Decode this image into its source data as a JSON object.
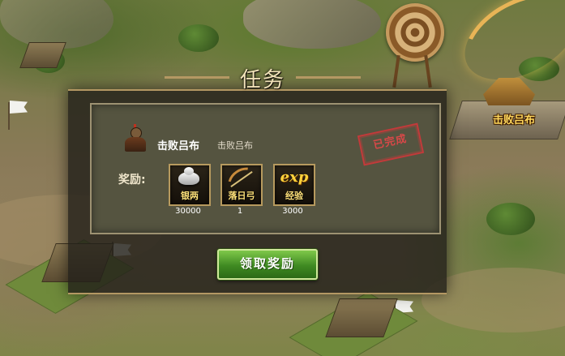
{
  "map": {
    "city_name": "击败吕布"
  },
  "dialog": {
    "title": "任务",
    "quest": {
      "name": "击败吕布",
      "description": "击败吕布",
      "status_stamp": "已完成"
    },
    "rewards_label": "奖励:",
    "rewards": [
      {
        "name": "银两",
        "quantity": "30000",
        "icon": "silver-ingot-icon"
      },
      {
        "name": "落日弓",
        "quantity": "1",
        "icon": "bow-icon"
      },
      {
        "name": "经验",
        "icon_text": "exp",
        "quantity": "3000",
        "icon": "exp-icon"
      }
    ],
    "claim_button": "领取奖励"
  },
  "colors": {
    "claim_button": "#3f8a22",
    "stamp": "#c23a3a",
    "title": "#f1e2b8",
    "reward_name": "#ffe27a"
  }
}
